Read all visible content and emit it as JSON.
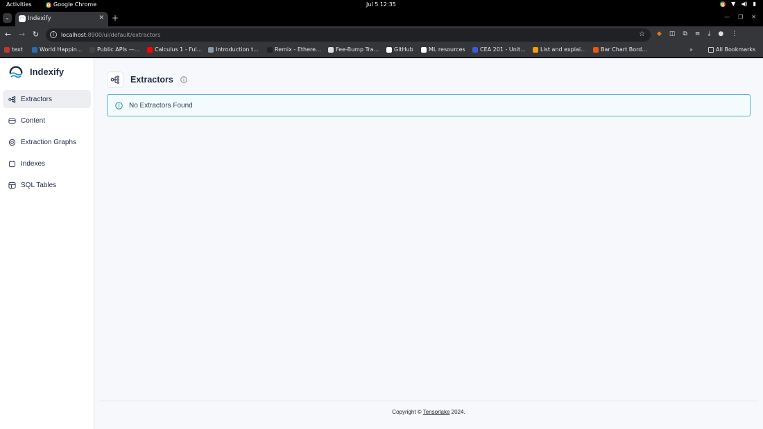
{
  "system": {
    "activities": "Activities",
    "app_name": "Google Chrome",
    "clock": "Jul 5  12:35"
  },
  "browser": {
    "tab_title": "Indexify",
    "url_host": "localhost",
    "url_path": ":8900/ui/default/extractors",
    "bookmarks": [
      {
        "label": "text",
        "icon": "bookmark-text-icon",
        "color": "#c0392b"
      },
      {
        "label": "World Happin...",
        "icon": "k-icon",
        "color": "#2b6cb0"
      },
      {
        "label": "Public APIs —...",
        "icon": "pi-icon",
        "color": "#444444"
      },
      {
        "label": "Calculus 1 - Ful...",
        "icon": "youtube-icon",
        "color": "#ff0000"
      },
      {
        "label": "Introduction t...",
        "icon": "page-icon",
        "color": "#8899aa"
      },
      {
        "label": "Remix - Ethere...",
        "icon": "ethereum-icon",
        "color": "#222222"
      },
      {
        "label": "Fee-Bump Tra...",
        "icon": "doc-icon",
        "color": "#dddddd"
      },
      {
        "label": "GitHub",
        "icon": "github-icon",
        "color": "#ffffff"
      },
      {
        "label": "ML resources",
        "icon": "github-icon",
        "color": "#ffffff"
      },
      {
        "label": "CEA 201 - Unit...",
        "icon": "circle-q-icon",
        "color": "#3b5bdb"
      },
      {
        "label": "List and explai...",
        "icon": "hook-icon",
        "color": "#f59f00"
      },
      {
        "label": "Bar Chart Bord...",
        "icon": "cube-icon",
        "color": "#e8590c"
      }
    ],
    "all_bookmarks": "All Bookmarks"
  },
  "app": {
    "brand": "Indexify",
    "nav": [
      {
        "label": "Extractors",
        "icon": "extractors-icon",
        "active": true
      },
      {
        "label": "Content",
        "icon": "content-icon",
        "active": false
      },
      {
        "label": "Extraction Graphs",
        "icon": "graph-icon",
        "active": false
      },
      {
        "label": "Indexes",
        "icon": "indexes-icon",
        "active": false
      },
      {
        "label": "SQL Tables",
        "icon": "table-icon",
        "active": false
      }
    ],
    "page_title": "Extractors",
    "alert": "No Extractors Found",
    "footer_prefix": "Copyright ©",
    "footer_link": "Tensorlake",
    "footer_suffix": "2024.",
    "colors": {
      "alert_border": "#4fb3c4",
      "alert_icon": "#1a8aa8",
      "brand_text": "#1f2a44",
      "logo": "#2b8cc4"
    }
  }
}
